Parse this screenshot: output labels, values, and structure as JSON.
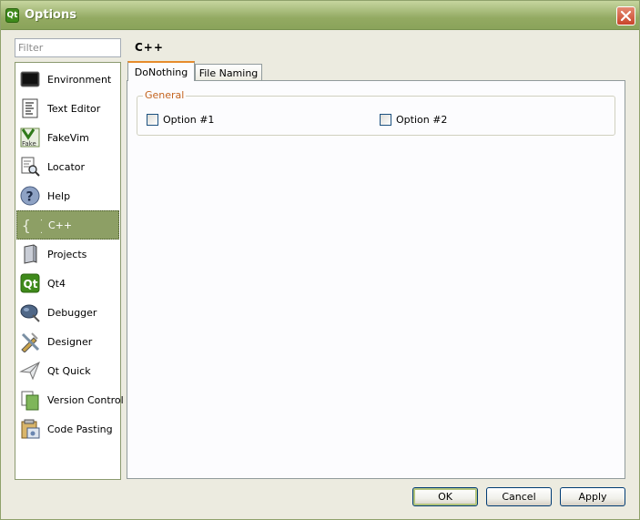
{
  "window": {
    "title": "Options",
    "app_icon_text": "Qt"
  },
  "filter": {
    "placeholder": "Filter",
    "value": ""
  },
  "categories": [
    {
      "label": "Environment",
      "icon": "monitor-icon"
    },
    {
      "label": "Text Editor",
      "icon": "text-document-icon"
    },
    {
      "label": "FakeVim",
      "icon": "fakevim-icon",
      "icon_text": "Fake"
    },
    {
      "label": "Locator",
      "icon": "magnifier-document-icon"
    },
    {
      "label": "Help",
      "icon": "question-icon",
      "icon_text": "?"
    },
    {
      "label": "C++",
      "icon": "braces-icon",
      "icon_text": "{ }",
      "selected": true
    },
    {
      "label": "Projects",
      "icon": "projects-icon"
    },
    {
      "label": "Qt4",
      "icon": "qt-icon",
      "icon_text": "Qt"
    },
    {
      "label": "Debugger",
      "icon": "bug-icon"
    },
    {
      "label": "Designer",
      "icon": "pencil-ruler-icon"
    },
    {
      "label": "Qt Quick",
      "icon": "paper-plane-icon"
    },
    {
      "label": "Version Control",
      "icon": "version-control-icon"
    },
    {
      "label": "Code Pasting",
      "icon": "clipboard-icon"
    }
  ],
  "page": {
    "title": "C++"
  },
  "tabs": [
    {
      "label": "DoNothing",
      "active": true
    },
    {
      "label": "File Naming",
      "active": false
    }
  ],
  "general_group": {
    "title": "General",
    "options": [
      {
        "label": "Option #1",
        "checked": false
      },
      {
        "label": "Option #2",
        "checked": false
      }
    ]
  },
  "buttons": {
    "ok": "OK",
    "cancel": "Cancel",
    "apply": "Apply"
  },
  "colors": {
    "title_bar": "#93aa62",
    "selection": "#8d9f65",
    "active_tab_accent": "#e68b2c",
    "group_title": "#c4641f",
    "close_button": "#c8452a"
  }
}
